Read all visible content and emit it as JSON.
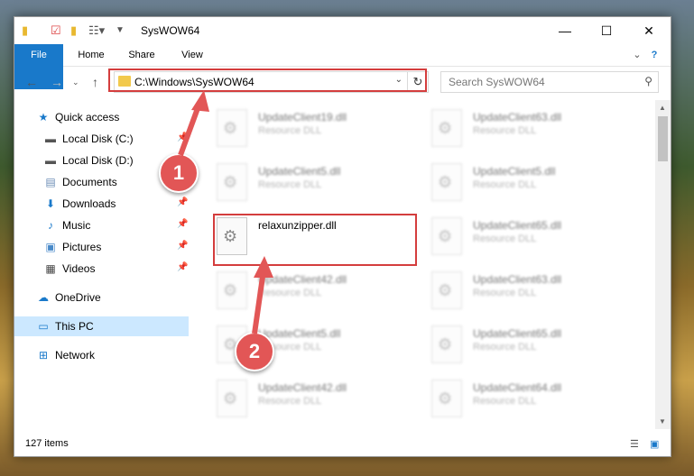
{
  "window": {
    "title": "SysWOW64",
    "controls": {
      "minimize": "—",
      "maximize": "☐",
      "close": "✕"
    }
  },
  "ribbon": {
    "tabs": [
      "File",
      "Home",
      "Share",
      "View"
    ]
  },
  "address": {
    "path": "C:\\Windows\\SysWOW64",
    "search_placeholder": "Search SysWOW64"
  },
  "sidebar": {
    "items": [
      {
        "label": "Quick access",
        "icon": "star-icon",
        "pinned": false
      },
      {
        "label": "Local Disk (C:)",
        "icon": "drive-icon",
        "pinned": true
      },
      {
        "label": "Local Disk (D:)",
        "icon": "drive-icon",
        "pinned": false
      },
      {
        "label": "Documents",
        "icon": "documents-icon",
        "pinned": true
      },
      {
        "label": "Downloads",
        "icon": "download-icon",
        "pinned": true
      },
      {
        "label": "Music",
        "icon": "music-icon",
        "pinned": true
      },
      {
        "label": "Pictures",
        "icon": "pictures-icon",
        "pinned": true
      },
      {
        "label": "Videos",
        "icon": "videos-icon",
        "pinned": true
      },
      {
        "label": "OneDrive",
        "icon": "cloud-icon",
        "pinned": false
      },
      {
        "label": "This PC",
        "icon": "computer-icon",
        "pinned": false,
        "selected": true
      },
      {
        "label": "Network",
        "icon": "network-icon",
        "pinned": false
      }
    ]
  },
  "files": [
    {
      "name": "UpdateClient19.dll",
      "desc": "Resource DLL",
      "blurred": true
    },
    {
      "name": "UpdateClient63.dll",
      "desc": "Resource DLL",
      "blurred": true
    },
    {
      "name": "UpdateClient5.dll",
      "desc": "Resource DLL",
      "blurred": true
    },
    {
      "name": "UpdateClient5.dll",
      "desc": "Resource DLL",
      "blurred": true
    },
    {
      "name": "relaxunzipper.dll",
      "desc": "",
      "blurred": false
    },
    {
      "name": "UpdateClient65.dll",
      "desc": "Resource DLL",
      "blurred": true
    },
    {
      "name": "UpdateClient42.dll",
      "desc": "Resource DLL",
      "blurred": true
    },
    {
      "name": "UpdateClient63.dll",
      "desc": "Resource DLL",
      "blurred": true
    },
    {
      "name": "UpdateClient5.dll",
      "desc": "Resource DLL",
      "blurred": true
    },
    {
      "name": "UpdateClient65.dll",
      "desc": "Resource DLL",
      "blurred": true
    },
    {
      "name": "UpdateClient42.dll",
      "desc": "Resource DLL",
      "blurred": true
    },
    {
      "name": "UpdateClient64.dll",
      "desc": "Resource DLL",
      "blurred": true
    }
  ],
  "status": {
    "item_count": "127 items"
  },
  "annotations": {
    "step1": "1",
    "step2": "2",
    "highlight_color": "#d43d3d",
    "badge_color": "#e25656"
  }
}
